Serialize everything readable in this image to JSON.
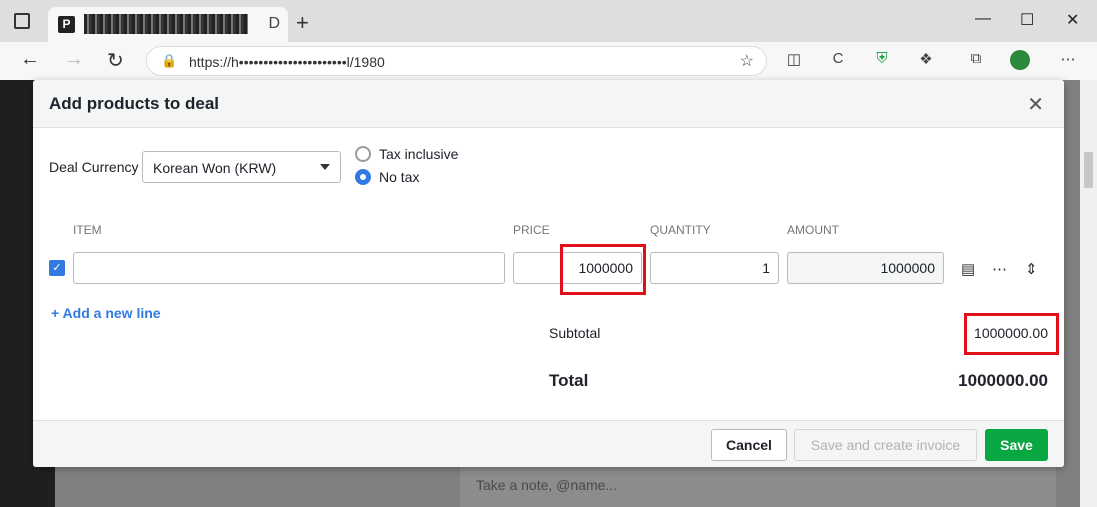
{
  "browser": {
    "url": "https://h••••••••••••••••••••••l/1980",
    "new_tab": "+",
    "tab_close": "D"
  },
  "background": {
    "note_placeholder": "Take a note, @name..."
  },
  "modal": {
    "title": "Add products to deal",
    "currency_label": "Deal Currency",
    "currency_value": "Korean Won (KRW)",
    "tax_options": [
      "Tax inclusive",
      "No tax"
    ],
    "selected_tax": "No tax",
    "columns": {
      "item": "ITEM",
      "price": "PRICE",
      "quantity": "QUANTITY",
      "amount": "AMOUNT"
    },
    "line_item": {
      "item": "",
      "price": "1000000",
      "quantity": "1",
      "amount": "1000000"
    },
    "add_line": "+ Add a new line",
    "subtotal_label": "Subtotal",
    "subtotal_value": "1000000.00",
    "total_label": "Total",
    "total_value": "1000000.00",
    "buttons": {
      "cancel": "Cancel",
      "save_invoice": "Save and create invoice",
      "save": "Save"
    }
  },
  "colors": {
    "accent": "#317ae2",
    "save": "#08a742",
    "highlight": "#e0101a"
  }
}
